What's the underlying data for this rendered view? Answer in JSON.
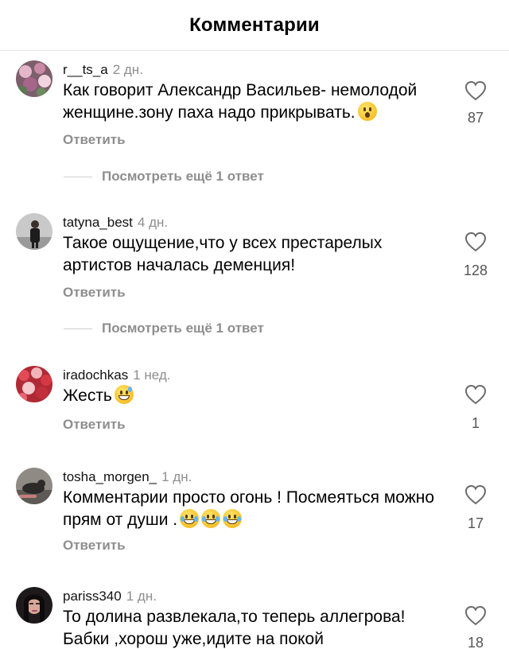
{
  "header": {
    "title": "Комментарии"
  },
  "comments": [
    {
      "username": "r__ts_a",
      "time": "2 дн.",
      "text": "Как говорит Александр Васильев- немолодой женщине.зону паха надо прикрывать.",
      "likes": "87",
      "reply_label": "Ответить",
      "more_replies": "Посмотреть ещё 1 ответ",
      "avatar_color": "#8a6a7a",
      "emoji": "astonished-emoji"
    },
    {
      "username": "tatyna_best",
      "time": "4 дн.",
      "text": "Такое ощущение,что у всех престарелых артистов началась деменция!",
      "likes": "128",
      "reply_label": "Ответить",
      "more_replies": "Посмотреть ещё 1 ответ",
      "avatar_color": "#b8b8b8"
    },
    {
      "username": "iradochkas",
      "time": "1 нед.",
      "text": "Жесть",
      "likes": "1",
      "reply_label": "Ответить",
      "avatar_color": "#c0303a",
      "emoji": "grinning-sweat-emoji"
    },
    {
      "username": "tosha_morgen_",
      "time": "1 дн.",
      "text": "Комментарии просто огонь ! Посмеяться можно прям от души .",
      "likes": "17",
      "reply_label": "Ответить",
      "avatar_color": "#6e6a66",
      "emoji": "tears-of-joy-emoji"
    },
    {
      "username": "pariss340",
      "time": "1 дн.",
      "text": "То долина развлекала,то теперь аллегрова! Бабки ,хорош уже,идите на покой",
      "likes": "18",
      "avatar_color": "#2a2224"
    }
  ],
  "icons": {
    "like": "heart-outline-icon"
  }
}
